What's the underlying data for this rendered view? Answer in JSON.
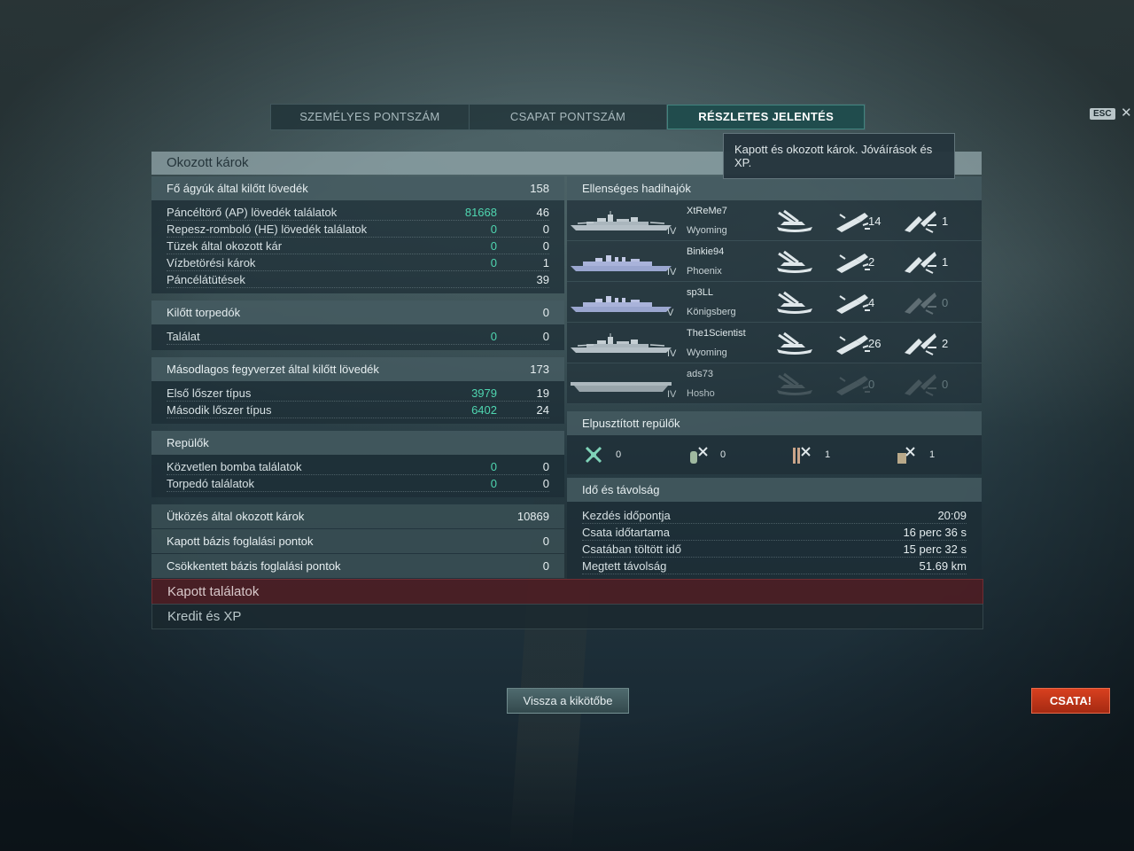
{
  "tabs": [
    {
      "label": "SZEMÉLYES PONTSZÁM"
    },
    {
      "label": "CSAPAT PONTSZÁM"
    },
    {
      "label": "RÉSZLETES JELENTÉS"
    }
  ],
  "esc_label": "ESC",
  "close_glyph": "✕",
  "tooltip": "Kapott és okozott károk. Jóváírások és XP.",
  "panel_title": "Okozott károk",
  "main_guns": {
    "title": "Fő ágyúk által kilőtt lövedék",
    "total": "158",
    "rows": [
      {
        "label": "Páncéltörő (AP) lövedék találatok",
        "dmg": "81668",
        "hits": "46"
      },
      {
        "label": "Repesz-romboló (HE) lövedék találatok",
        "dmg": "0",
        "hits": "0"
      },
      {
        "label": "Tüzek által okozott kár",
        "dmg": "0",
        "hits": "0"
      },
      {
        "label": "Vízbetörési károk",
        "dmg": "0",
        "hits": "1"
      },
      {
        "label": "Páncélátütések",
        "dmg": "",
        "hits": "39"
      }
    ]
  },
  "torpedoes": {
    "title": "Kilőtt torpedók",
    "total": "0",
    "rows": [
      {
        "label": "Találat",
        "dmg": "0",
        "hits": "0"
      }
    ]
  },
  "secondary": {
    "title": "Másodlagos fegyverzet által kilőtt lövedék",
    "total": "173",
    "rows": [
      {
        "label": "Első lőszer típus",
        "dmg": "3979",
        "hits": "19"
      },
      {
        "label": "Második lőszer típus",
        "dmg": "6402",
        "hits": "24"
      }
    ]
  },
  "aircraft": {
    "title": "Repülők",
    "rows": [
      {
        "label": "Közvetlen bomba találatok",
        "dmg": "0",
        "hits": "0"
      },
      {
        "label": "Torpedó találatok",
        "dmg": "0",
        "hits": "0"
      }
    ]
  },
  "ramming": {
    "label": "Ütközés által okozott károk",
    "value": "10869"
  },
  "base_capture": {
    "label": "Kapott bázis foglalási pontok",
    "value": "0"
  },
  "base_reduced": {
    "label": "Csökkentett bázis foglalási pontok",
    "value": "0"
  },
  "enemy_ships": {
    "title": "Ellenséges hadihajók",
    "ships": [
      {
        "player": "XtReMe7",
        "ship": "Wyoming",
        "tier": "IV",
        "hits": "14",
        "kills": "1",
        "active": true
      },
      {
        "player": "Binkie94",
        "ship": "Phoenix",
        "tier": "IV",
        "hits": "2",
        "kills": "1",
        "active": true
      },
      {
        "player": "sp3LL",
        "ship": "Königsberg",
        "tier": "V",
        "hits": "4",
        "kills": "0",
        "active": true
      },
      {
        "player": "The1Scientist",
        "ship": "Wyoming",
        "tier": "IV",
        "hits": "26",
        "kills": "2",
        "active": true
      },
      {
        "player": "ads73",
        "ship": "Hosho",
        "tier": "IV",
        "hits": "0",
        "kills": "0",
        "active": false
      }
    ]
  },
  "planes_destroyed": {
    "title": "Elpusztított repülők",
    "items": [
      {
        "icon": "fighter-plane-icon",
        "count": "0"
      },
      {
        "icon": "torpedo-bomber-icon",
        "count": "0"
      },
      {
        "icon": "dive-bomber-icon",
        "count": "1"
      },
      {
        "icon": "spotter-plane-icon",
        "count": "1"
      }
    ]
  },
  "time": {
    "title": "Idő és távolság",
    "rows": [
      {
        "label": "Kezdés időpontja",
        "value": "20:09"
      },
      {
        "label": "Csata időtartama",
        "value": "16 perc 36 s"
      },
      {
        "label": "Csatában töltött idő",
        "value": "15 perc 32 s"
      },
      {
        "label": "Megtett távolság",
        "value": "51.69 km"
      }
    ]
  },
  "received_hits": "Kapott találatok",
  "credits_xp": "Kredit és XP",
  "back_button": "Vissza a kikötőbe",
  "battle_button": "CSATA!"
}
